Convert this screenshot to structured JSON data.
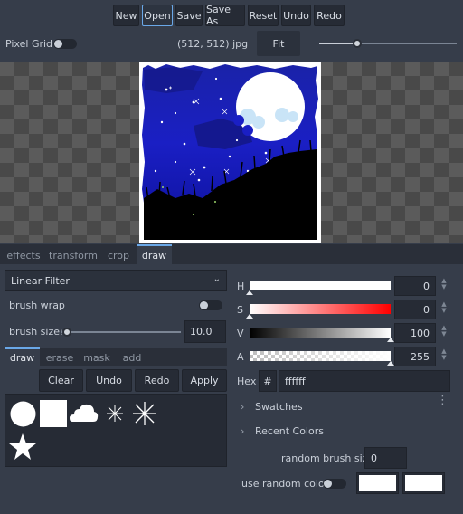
{
  "toolbar": {
    "new": "New",
    "open": "Open",
    "save": "Save",
    "save_as": "Save As",
    "reset": "Reset",
    "undo": "Undo",
    "redo": "Redo"
  },
  "info_bar": {
    "pixel_grid_label": "Pixel Grid",
    "image_info": "(512, 512) jpg",
    "fit_label": "Fit",
    "zoom_level": 0.3
  },
  "main_tabs": [
    {
      "label": "effects"
    },
    {
      "label": "transform"
    },
    {
      "label": "crop"
    },
    {
      "label": "draw",
      "active": true
    }
  ],
  "filter": {
    "selected": "Linear Filter"
  },
  "brush": {
    "wrap_label": "brush wrap",
    "size_label": "brush size:",
    "size_value": "10.0",
    "size_fraction": 0.02
  },
  "sub_tabs": [
    {
      "label": "draw",
      "active": true
    },
    {
      "label": "erase"
    },
    {
      "label": "mask"
    },
    {
      "label": "add"
    }
  ],
  "actions": {
    "clear": "Clear",
    "undo": "Undo",
    "redo": "Redo",
    "apply": "Apply"
  },
  "brush_shapes": [
    "circle",
    "square",
    "cloud",
    "small-sparkle",
    "large-sparkle",
    "star"
  ],
  "color": {
    "h_label": "H",
    "h_value": "0",
    "s_label": "S",
    "s_value": "0",
    "v_label": "V",
    "v_value": "100",
    "a_label": "A",
    "a_value": "255",
    "hex_label": "Hex",
    "hex_hash": "#",
    "hex_value": "ffffff",
    "current_color": "#ffffff"
  },
  "swatches_label": "Swatches",
  "recent_colors_label": "Recent Colors",
  "random_brush_size_label": "random brush size",
  "random_brush_size_value": "0",
  "use_random_color_label": "use random color",
  "accent": "#6aa8e8"
}
